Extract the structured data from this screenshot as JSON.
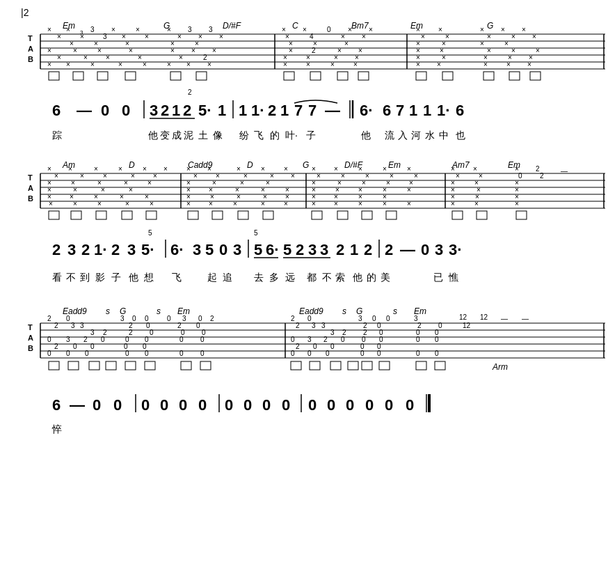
{
  "page": {
    "number": "12",
    "sections": [
      {
        "id": "section1",
        "chords": [
          "Em",
          "G",
          "D/#F",
          "C",
          "Bm7",
          "Em",
          "G"
        ],
        "chord_positions": [
          70,
          220,
          310,
          410,
          510,
          590,
          700
        ],
        "notation": "6 — 0 0 | 3̲ 2̲1̲2̲ 5·1 | 1 1·2 1 7 7 — | 6· 6 7 1 1 1·6",
        "lyrics": "踪　　　　他 变 成 泥 土 像 纷 飞 的 叶·子　　他　 流 入 河 水 中 也"
      },
      {
        "id": "section2",
        "chords": [
          "Am",
          "D",
          "Cadd9",
          "D",
          "G",
          "D/#F",
          "Em",
          "Am7",
          "Em"
        ],
        "chord_positions": [
          70,
          165,
          255,
          335,
          415,
          480,
          545,
          640,
          720
        ],
        "notation": "2 3 2 1·2 3 5· | 5/6· 3 5 0 3 | 5 5̲6̲·5̲2̲3̲3̲ 2 1 2 | 2 — 0 3 3·",
        "lyrics": "看 不 到 影 子 他 想　飞　 起 追　 去 多 远　都 不 索　他 的 美　　 已 憔"
      },
      {
        "id": "section3",
        "chords": [
          "Eadd9",
          "s",
          "G",
          "s",
          "Em",
          "Eadd9",
          "s",
          "G",
          "s",
          "Em"
        ],
        "chord_positions": [
          70,
          120,
          150,
          200,
          250,
          410,
          460,
          490,
          540,
          590
        ],
        "notation": "6 — 0 0 | 0 0 0 0 | 0 0 0 0 | 0 0 0 0 0 0",
        "lyrics": "悴"
      }
    ]
  },
  "colors": {
    "primary": "#000000",
    "background": "#ffffff"
  }
}
